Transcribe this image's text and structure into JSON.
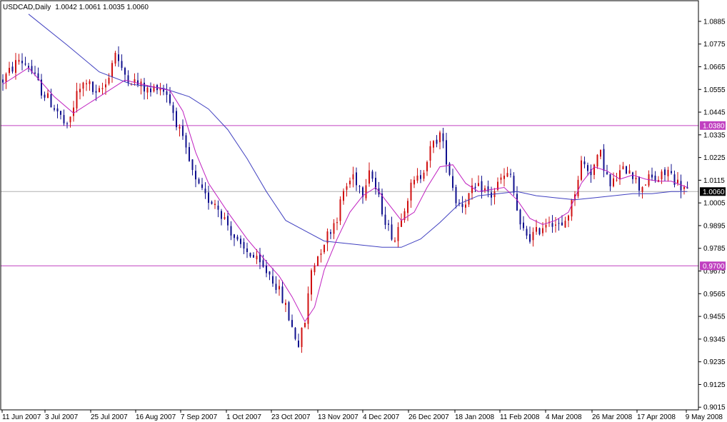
{
  "header": {
    "symbol": "USDCAD,Daily",
    "ohlc": "1.0042 1.0061 1.0035 1.0060"
  },
  "colors": {
    "up_candle": "#d01010",
    "down_candle": "#10108e",
    "ma_fast": "#c020c0",
    "ma_slow": "#4040c0",
    "hline": "#c040c0",
    "current_line": "#b0b0b0",
    "frame": "#000000"
  },
  "chart_data": {
    "type": "candlestick",
    "title": "USDCAD,Daily",
    "x_tick_labels": [
      "11 Jun 2007",
      "3 Jul 2007",
      "25 Jul 2007",
      "16 Aug 2007",
      "7 Sep 2007",
      "1 Oct 2007",
      "23 Oct 2007",
      "13 Nov 2007",
      "4 Dec 2007",
      "26 Dec 2007",
      "18 Jan 2008",
      "11 Feb 2008",
      "4 Mar 2008",
      "26 Mar 2008",
      "17 Apr 2008",
      "9 May 2008"
    ],
    "y_tick_labels": [
      "1.0885",
      "1.0775",
      "1.0665",
      "1.0555",
      "1.0445",
      "1.0335",
      "1.0225",
      "1.0115",
      "1.0005",
      "0.9895",
      "0.9785",
      "0.9675",
      "0.9565",
      "0.9455",
      "0.9345",
      "0.9235",
      "0.9125",
      "0.9015"
    ],
    "ylim": [
      0.9002,
      1.0985
    ],
    "horizontal_lines": [
      {
        "value": 1.038,
        "label": "1.0380"
      },
      {
        "value": 0.97,
        "label": "0.9700"
      }
    ],
    "current_price": {
      "value": 1.006,
      "label": "1.0060"
    },
    "price_path": [
      [
        0,
        1.06
      ],
      [
        5,
        1.07
      ],
      [
        8,
        1.067
      ],
      [
        12,
        1.055
      ],
      [
        17,
        1.045
      ],
      [
        20,
        1.036
      ],
      [
        23,
        1.053
      ],
      [
        26,
        1.06
      ],
      [
        29,
        1.052
      ],
      [
        32,
        1.058
      ],
      [
        35,
        1.074
      ],
      [
        37,
        1.064
      ],
      [
        42,
        1.058
      ],
      [
        46,
        1.054
      ],
      [
        48,
        1.058
      ],
      [
        51,
        1.054
      ],
      [
        54,
        1.04
      ],
      [
        58,
        1.02
      ],
      [
        60,
        1.01
      ],
      [
        63,
        1.003
      ],
      [
        66,
        1.001
      ],
      [
        70,
        0.99
      ],
      [
        74,
        0.978
      ],
      [
        77,
        0.976
      ],
      [
        80,
        0.97
      ],
      [
        83,
        0.966
      ],
      [
        85,
        0.961
      ],
      [
        88,
        0.95
      ],
      [
        90,
        0.94
      ],
      [
        92,
        0.932
      ],
      [
        94,
        0.943
      ],
      [
        96,
        0.968
      ],
      [
        100,
        0.982
      ],
      [
        104,
        0.994
      ],
      [
        106,
        1.006
      ],
      [
        109,
        1.014
      ],
      [
        112,
        1.006
      ],
      [
        114,
        1.018
      ],
      [
        117,
        1.002
      ],
      [
        120,
        0.988
      ],
      [
        122,
        0.983
      ],
      [
        124,
        0.995
      ],
      [
        127,
        1.008
      ],
      [
        130,
        1.014
      ],
      [
        133,
        1.026
      ],
      [
        136,
        1.034
      ],
      [
        138,
        1.022
      ],
      [
        141,
        1.002
      ],
      [
        143,
        1.0
      ],
      [
        146,
        1.006
      ],
      [
        149,
        1.008
      ],
      [
        152,
        1.004
      ],
      [
        155,
        1.012
      ],
      [
        158,
        1.014
      ],
      [
        161,
        0.988
      ],
      [
        164,
        0.984
      ],
      [
        166,
        0.986
      ],
      [
        170,
        0.993
      ],
      [
        174,
        0.988
      ],
      [
        177,
        1.0
      ],
      [
        180,
        1.02
      ],
      [
        183,
        1.016
      ],
      [
        186,
        1.024
      ],
      [
        189,
        1.008
      ],
      [
        192,
        1.015
      ],
      [
        195,
        1.018
      ],
      [
        198,
        1.008
      ],
      [
        201,
        1.012
      ],
      [
        204,
        1.012
      ],
      [
        207,
        1.016
      ],
      [
        210,
        1.01
      ],
      [
        213,
        1.006
      ]
    ],
    "ma_fast_path": [
      [
        0,
        1.058
      ],
      [
        8,
        1.066
      ],
      [
        16,
        1.052
      ],
      [
        22,
        1.044
      ],
      [
        30,
        1.052
      ],
      [
        38,
        1.06
      ],
      [
        46,
        1.057
      ],
      [
        52,
        1.055
      ],
      [
        56,
        1.045
      ],
      [
        60,
        1.025
      ],
      [
        64,
        1.01
      ],
      [
        70,
        0.996
      ],
      [
        76,
        0.983
      ],
      [
        82,
        0.972
      ],
      [
        86,
        0.965
      ],
      [
        90,
        0.955
      ],
      [
        94,
        0.943
      ],
      [
        97,
        0.95
      ],
      [
        100,
        0.968
      ],
      [
        104,
        0.983
      ],
      [
        108,
        0.996
      ],
      [
        112,
        1.004
      ],
      [
        116,
        1.008
      ],
      [
        120,
        1.0
      ],
      [
        124,
        0.992
      ],
      [
        128,
        0.996
      ],
      [
        132,
        1.008
      ],
      [
        136,
        1.018
      ],
      [
        140,
        1.019
      ],
      [
        144,
        1.01
      ],
      [
        148,
        1.006
      ],
      [
        152,
        1.007
      ],
      [
        156,
        1.008
      ],
      [
        160,
        1.002
      ],
      [
        164,
        0.993
      ],
      [
        168,
        0.99
      ],
      [
        172,
        0.992
      ],
      [
        176,
        0.996
      ],
      [
        180,
        1.01
      ],
      [
        184,
        1.018
      ],
      [
        188,
        1.016
      ],
      [
        192,
        1.012
      ],
      [
        196,
        1.014
      ],
      [
        200,
        1.012
      ],
      [
        204,
        1.011
      ],
      [
        208,
        1.011
      ],
      [
        213,
        1.008
      ]
    ],
    "ma_slow_path": [
      [
        8,
        1.092
      ],
      [
        20,
        1.077
      ],
      [
        30,
        1.064
      ],
      [
        40,
        1.058
      ],
      [
        50,
        1.056
      ],
      [
        58,
        1.052
      ],
      [
        64,
        1.046
      ],
      [
        70,
        1.036
      ],
      [
        76,
        1.022
      ],
      [
        82,
        1.006
      ],
      [
        88,
        0.992
      ],
      [
        94,
        0.987
      ],
      [
        100,
        0.982
      ],
      [
        106,
        0.981
      ],
      [
        112,
        0.98
      ],
      [
        118,
        0.979
      ],
      [
        124,
        0.979
      ],
      [
        130,
        0.983
      ],
      [
        136,
        0.991
      ],
      [
        142,
        1.0
      ],
      [
        148,
        1.004
      ],
      [
        154,
        1.005
      ],
      [
        160,
        1.006
      ],
      [
        166,
        1.004
      ],
      [
        172,
        1.003
      ],
      [
        178,
        1.002
      ],
      [
        184,
        1.003
      ],
      [
        190,
        1.004
      ],
      [
        196,
        1.005
      ],
      [
        202,
        1.005
      ],
      [
        208,
        1.006
      ],
      [
        213,
        1.006
      ]
    ],
    "legend": "none",
    "grid": false
  }
}
